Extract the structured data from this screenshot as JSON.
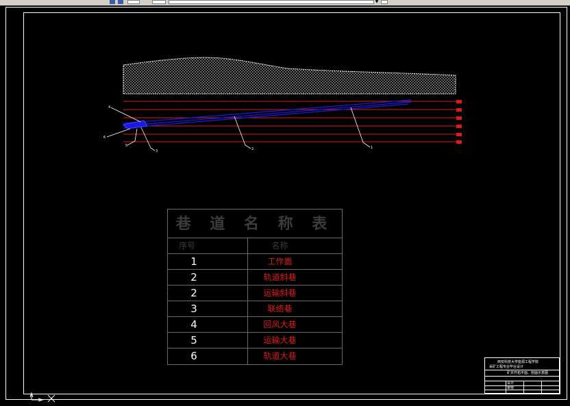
{
  "table": {
    "title": "巷 道 名 称 表",
    "header": {
      "no": "序号",
      "name": "名称"
    },
    "rows": [
      {
        "no": "1",
        "name": "工作面"
      },
      {
        "no": "2",
        "name": "轨道斜巷"
      },
      {
        "no": "2",
        "name": "运输斜巷"
      },
      {
        "no": "3",
        "name": "联络巷"
      },
      {
        "no": "4",
        "name": "回风大巷"
      },
      {
        "no": "5",
        "name": "运输大巷"
      },
      {
        "no": "6",
        "name": "轨道大巷"
      }
    ]
  },
  "drawing": {
    "callouts": [
      "1",
      "2",
      "3",
      "4",
      "5",
      "6"
    ]
  },
  "title_block": {
    "line1": "西安科技大学能源工程学院",
    "line2": "采矿工程专业毕业设计",
    "line3": "矿井开拓平面、剖面示意图",
    "line4": "设计",
    "line5": "审核"
  },
  "colors": {
    "background": "#000000",
    "roadway": "#e01818",
    "inclined": "#1a1ae6",
    "table_grid": "#6a6a6a",
    "table_name_text": "#e01818"
  }
}
